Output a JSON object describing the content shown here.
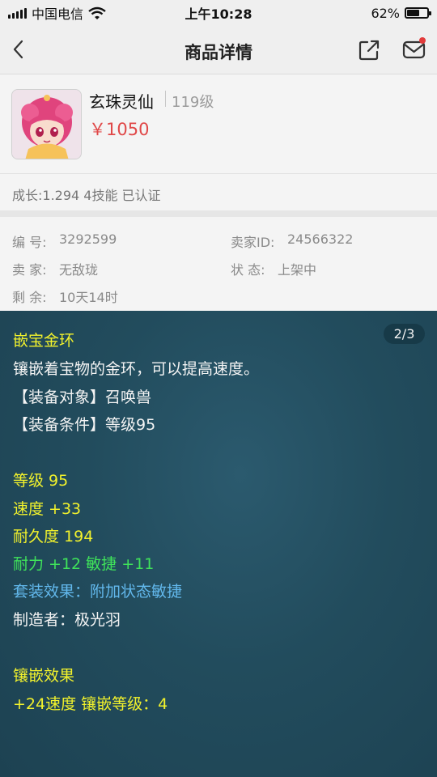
{
  "status_bar": {
    "carrier": "中国电信",
    "time": "上午10:28",
    "battery": "62%",
    "battery_level": 0.62
  },
  "nav": {
    "title": "商品详情"
  },
  "product": {
    "name": "玄珠灵仙",
    "level": "119级",
    "price": "￥1050",
    "growth": "成长:1.294 4技能 已认证"
  },
  "info": {
    "id_label": "编 号:",
    "id_value": "3292599",
    "seller_id_label": "卖家ID:",
    "seller_id_value": "24566322",
    "seller_label": "卖 家:",
    "seller_value": "无敌珑",
    "status_label": "状 态:",
    "status_value": "上架中",
    "remaining_label": "剩 余:",
    "remaining_value": "10天14时"
  },
  "tooltip": {
    "pager": "2/3",
    "title": "嵌宝金环",
    "desc": "镶嵌着宝物的金环，可以提高速度。",
    "target": "【装备对象】召唤兽",
    "condition": "【装备条件】等级95",
    "level": "等级 95",
    "speed": "速度 +33",
    "durability": "耐久度 194",
    "bonus": "耐力 +12 敏捷 +11",
    "set_effect": "套装效果：附加状态敏捷",
    "maker": "制造者：极光羽",
    "inlay_title": "镶嵌效果",
    "inlay_detail": "+24速度 镶嵌等级：4"
  }
}
